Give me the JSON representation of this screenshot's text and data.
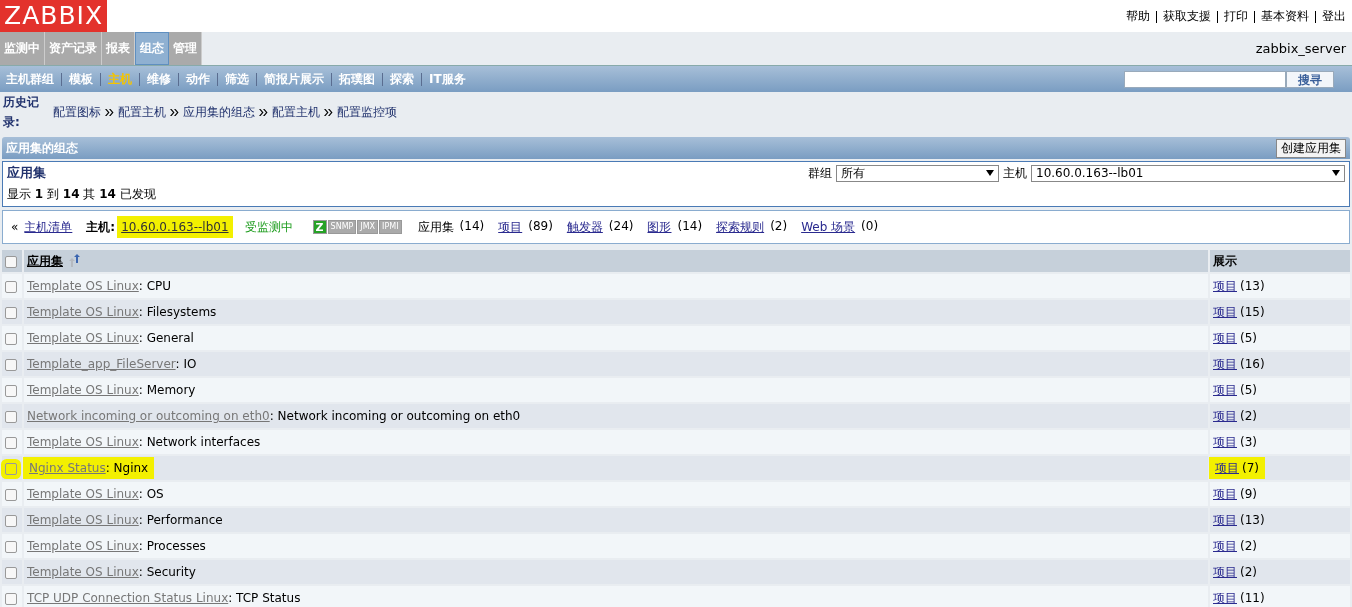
{
  "header": {
    "logo": "ZABBIX",
    "top_links": [
      "帮助",
      "获取支援",
      "打印",
      "基本资料",
      "登出"
    ]
  },
  "main_menu": {
    "items": [
      {
        "label": "监测中",
        "selected": false
      },
      {
        "label": "资产记录",
        "selected": false
      },
      {
        "label": "报表",
        "selected": false
      },
      {
        "label": "组态",
        "selected": true
      },
      {
        "label": "管理",
        "selected": false
      }
    ],
    "server_name": "zabbix_server"
  },
  "sub_menu": {
    "items": [
      {
        "label": "主机群组",
        "selected": false
      },
      {
        "label": "模板",
        "selected": false
      },
      {
        "label": "主机",
        "selected": true
      },
      {
        "label": "维修",
        "selected": false
      },
      {
        "label": "动作",
        "selected": false
      },
      {
        "label": "筛选",
        "selected": false
      },
      {
        "label": "简报片展示",
        "selected": false
      },
      {
        "label": "拓璞图",
        "selected": false
      },
      {
        "label": "探索",
        "selected": false
      },
      {
        "label": "IT服务",
        "selected": false
      }
    ],
    "search_button": "搜寻"
  },
  "history": {
    "label": "历史记录:",
    "items": [
      "配置图标",
      "配置主机",
      "应用集的组态",
      "配置主机",
      "配置监控项"
    ]
  },
  "section": {
    "title": "应用集的组态",
    "create_button": "创建应用集"
  },
  "filter": {
    "title": "应用集",
    "group_label": "群组",
    "group_value": "所有",
    "host_label": "主机",
    "host_value": "10.60.0.163--lb01",
    "summary": "显示 **1** 到 **14** 其 **14** 已发现"
  },
  "host_bar": {
    "back": "«",
    "host_list": "主机清单",
    "host_label": "主机:",
    "host_name": "10.60.0.163--lb01",
    "host_highlighted": true,
    "status": "受监测中",
    "availability": [
      {
        "label": "Z",
        "active": true
      },
      {
        "label": "SNMP",
        "active": false
      },
      {
        "label": "JMX",
        "active": false
      },
      {
        "label": "IPMI",
        "active": false
      }
    ],
    "links": [
      {
        "kind": "text",
        "label": "应用集",
        "count": "(14)"
      },
      {
        "kind": "link",
        "label": "项目",
        "count": "(89)"
      },
      {
        "kind": "link",
        "label": "触发器",
        "count": "(24)"
      },
      {
        "kind": "link",
        "label": "图形",
        "count": "(14)"
      },
      {
        "kind": "link",
        "label": "探索规则",
        "count": "(2)"
      },
      {
        "kind": "link",
        "label": "Web 场景",
        "count": "(0)"
      }
    ]
  },
  "table": {
    "select_all_checked": false,
    "columns": [
      {
        "label": "应用集"
      },
      {
        "label": "展示"
      }
    ],
    "rows": [
      {
        "template": "Template OS Linux",
        "name": ": CPU",
        "items_label": "项目",
        "items_count": "(13)",
        "highlighted": false,
        "checked": false
      },
      {
        "template": "Template OS Linux",
        "name": ": Filesystems",
        "items_label": "项目",
        "items_count": "(15)",
        "highlighted": false,
        "checked": false
      },
      {
        "template": "Template OS Linux",
        "name": ": General",
        "items_label": "项目",
        "items_count": "(5)",
        "highlighted": false,
        "checked": false
      },
      {
        "template": "Template_app_FileServer",
        "name": ": IO",
        "items_label": "项目",
        "items_count": "(16)",
        "highlighted": false,
        "checked": false
      },
      {
        "template": "Template OS Linux",
        "name": ": Memory",
        "items_label": "项目",
        "items_count": "(5)",
        "highlighted": false,
        "checked": false
      },
      {
        "template": "Network incoming or outcoming on eth0",
        "name": ": Network incoming or outcoming on eth0",
        "items_label": "项目",
        "items_count": "(2)",
        "highlighted": false,
        "checked": false
      },
      {
        "template": "Template OS Linux",
        "name": ": Network interfaces",
        "items_label": "项目",
        "items_count": "(3)",
        "highlighted": false,
        "checked": false
      },
      {
        "template": "Nginx Status",
        "name": ": Nginx",
        "items_label": "项目",
        "items_count": "(7)",
        "highlighted": true,
        "checked": false
      },
      {
        "template": "Template OS Linux",
        "name": ": OS",
        "items_label": "项目",
        "items_count": "(9)",
        "highlighted": false,
        "checked": false
      },
      {
        "template": "Template OS Linux",
        "name": ": Performance",
        "items_label": "项目",
        "items_count": "(13)",
        "highlighted": false,
        "checked": false
      },
      {
        "template": "Template OS Linux",
        "name": ": Processes",
        "items_label": "项目",
        "items_count": "(2)",
        "highlighted": false,
        "checked": false
      },
      {
        "template": "Template OS Linux",
        "name": ": Security",
        "items_label": "项目",
        "items_count": "(2)",
        "highlighted": false,
        "checked": false
      },
      {
        "template": "TCP UDP Connection Status Linux",
        "name": ": TCP Status",
        "items_label": "项目",
        "items_count": "(11)",
        "highlighted": false,
        "checked": false
      }
    ]
  }
}
